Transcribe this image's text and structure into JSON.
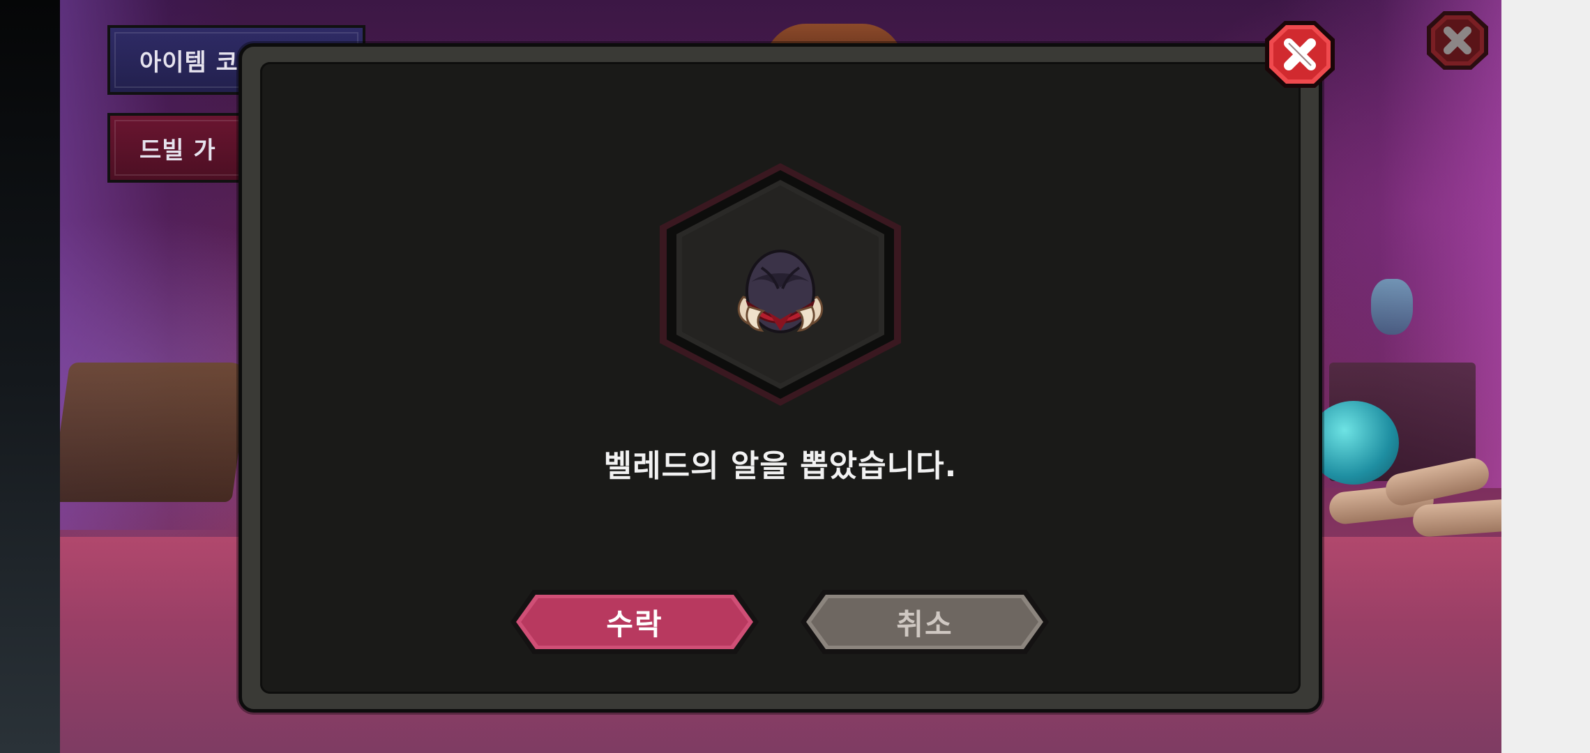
{
  "background": {
    "menu": {
      "item_code_label": "아이템 코",
      "drill_label": "드빌 가"
    }
  },
  "dialog": {
    "item_name_icon": "dark-egg-icon",
    "message": "벨레드의 알을 뽑았습니다.",
    "accept_label": "수락",
    "cancel_label": "취소"
  },
  "icons": {
    "close": "close-x-icon"
  },
  "colors": {
    "accept": "#b8395f",
    "cancel": "#6e6761",
    "close": "#d12a2f",
    "dialog_bg": "#1a1a18"
  }
}
